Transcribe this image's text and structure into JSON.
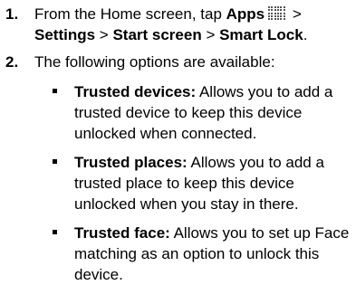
{
  "step1": {
    "number": "1.",
    "prefix": "From the Home screen, tap ",
    "apps": "Apps",
    "sep1": " > ",
    "settings": "Settings",
    "sep2": " > ",
    "start_screen": "Start screen",
    "sep3": " > ",
    "smart_lock": "Smart Lock",
    "suffix": ".",
    "apps_icon": "grid-icon"
  },
  "step2": {
    "number": "2.",
    "text": "The following options are available:"
  },
  "options": [
    {
      "term": "Trusted devices:",
      "description": " Allows you to add a trusted device to keep this device unlocked when connected."
    },
    {
      "term": "Trusted places:",
      "description": " Allows you to add a trusted place to keep this device unlocked when you stay in there."
    },
    {
      "term": "Trusted face:",
      "description": " Allows you to set up Face matching as an option to unlock this device."
    }
  ]
}
